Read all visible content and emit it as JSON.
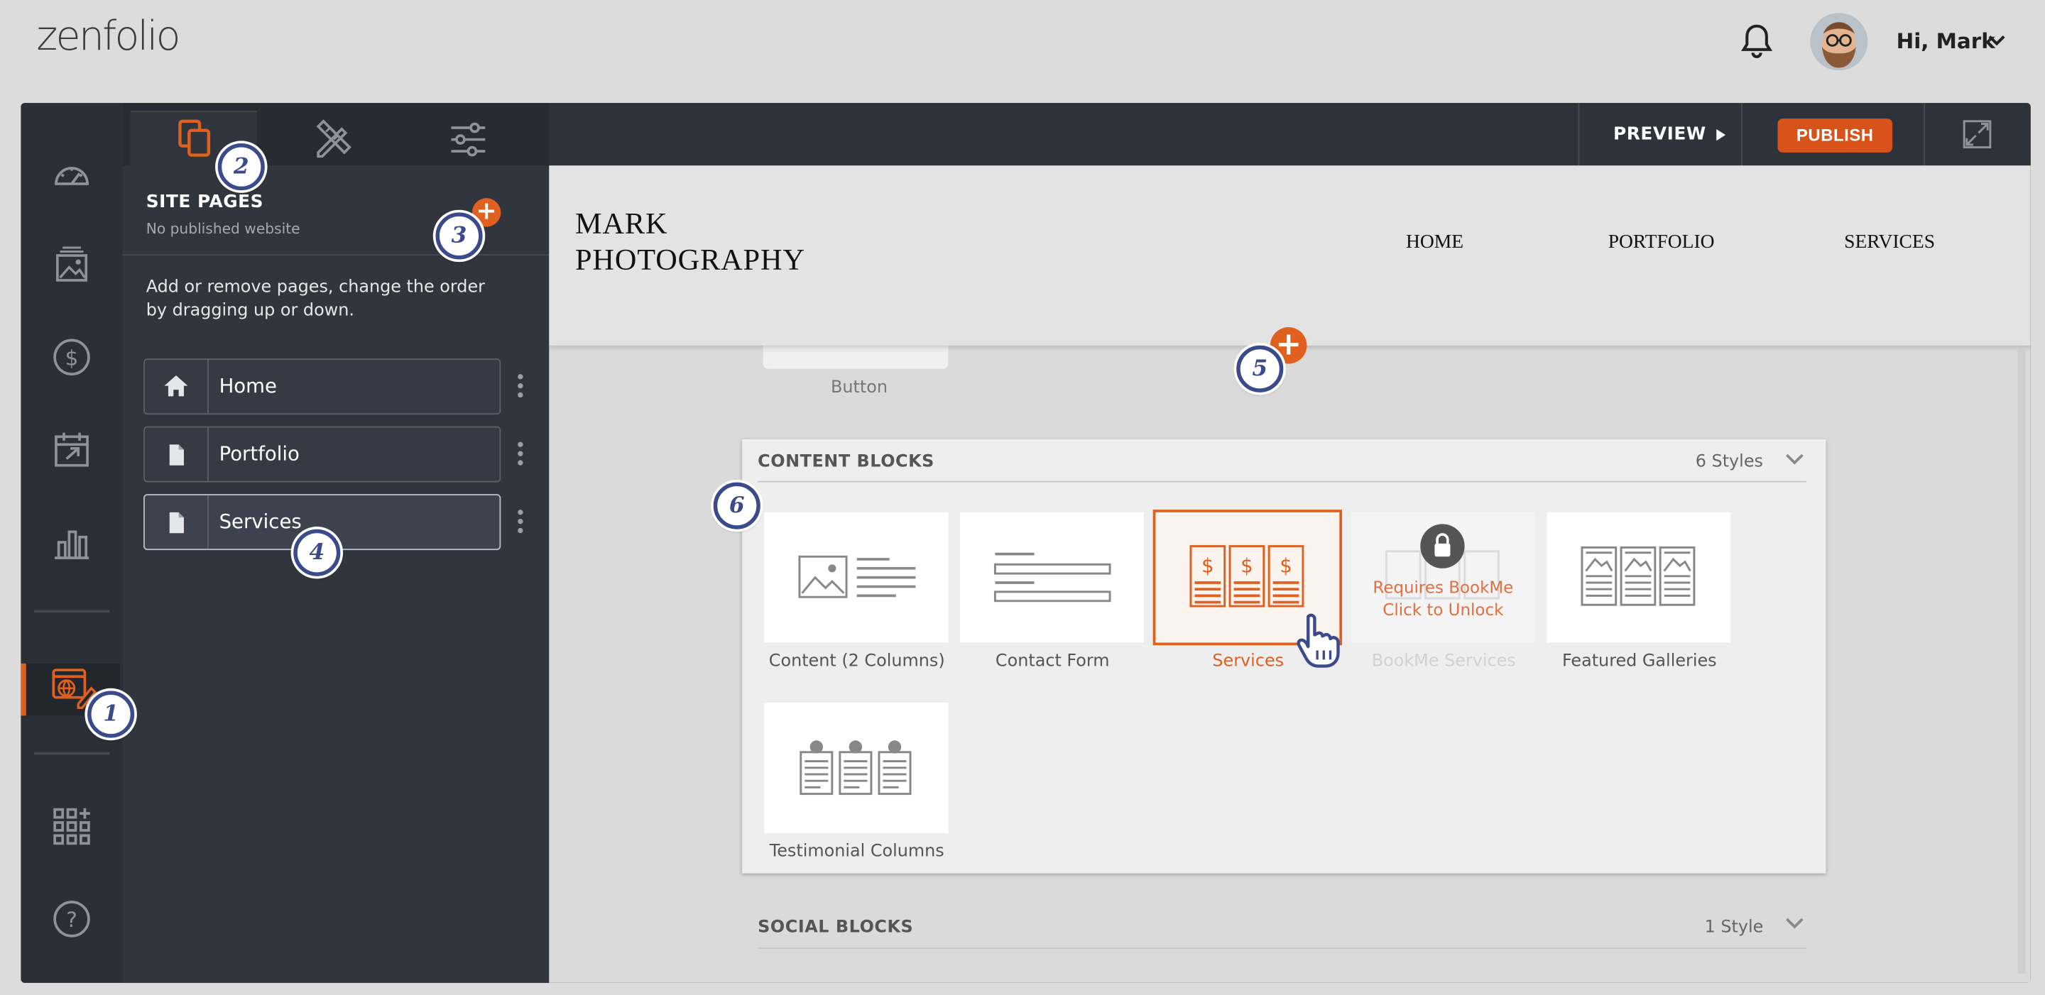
{
  "app": {
    "logo_text": "zenfolio"
  },
  "header": {
    "greeting": "Hi, Mark"
  },
  "panel": {
    "section_title": "SITE PAGES",
    "section_subtitle": "No published website",
    "help_text": "Add or remove pages, change the order by dragging up or down.",
    "pages": [
      {
        "label": "Home",
        "icon": "home-icon"
      },
      {
        "label": "Portfolio",
        "icon": "page-icon"
      },
      {
        "label": "Services",
        "icon": "page-icon",
        "active": true
      }
    ]
  },
  "toolbar": {
    "preview_label": "PREVIEW",
    "publish_label": "PUBLISH"
  },
  "site": {
    "brand_line1": "MARK",
    "brand_line2": "PHOTOGRAPHY",
    "nav": [
      "HOME",
      "PORTFOLIO",
      "SERVICES"
    ]
  },
  "button_block": {
    "caption": "Button"
  },
  "content_blocks": {
    "title": "CONTENT BLOCKS",
    "count": "6 Styles",
    "tiles": [
      {
        "caption": "Content (2 Columns)"
      },
      {
        "caption": "Contact Form"
      },
      {
        "caption": "Services",
        "selected": true
      },
      {
        "caption": "BookMe Services",
        "locked": true,
        "lock_line1": "Requires BookMe",
        "lock_line2": "Click to Unlock"
      },
      {
        "caption": "Featured Galleries"
      },
      {
        "caption": "Testimonial Columns"
      }
    ]
  },
  "social_blocks": {
    "title": "SOCIAL BLOCKS",
    "count": "1 Style"
  },
  "badges": [
    "1",
    "2",
    "3",
    "4",
    "5",
    "6"
  ],
  "colors": {
    "accent": "#e0601f",
    "rail": "#2b3038",
    "panel": "#30353e",
    "badge": "#3b4a8a"
  }
}
